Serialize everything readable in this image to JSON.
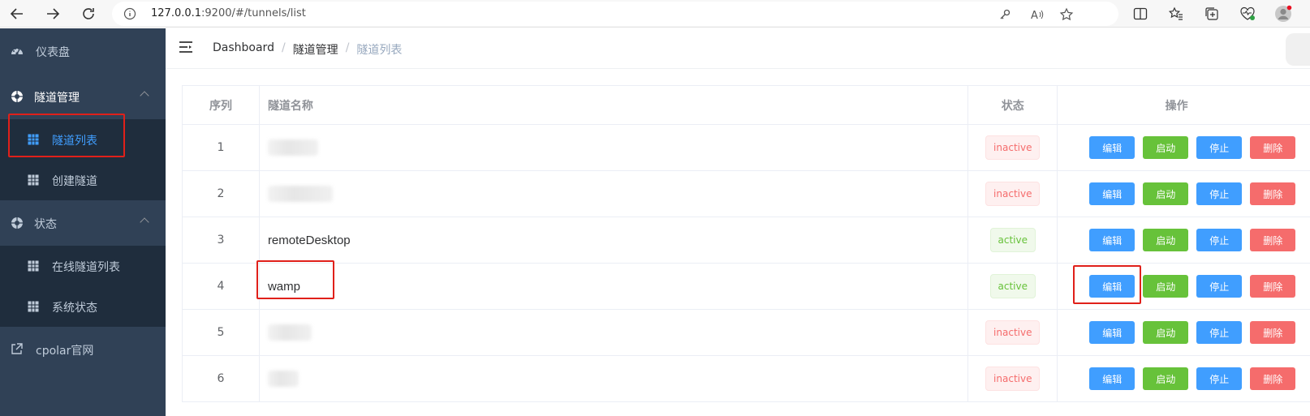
{
  "browser": {
    "url_host": "127.0.0.1",
    "url_rest": ":9200/#/tunnels/list"
  },
  "sidebar": {
    "dashboard": "仪表盘",
    "tunnel_mgmt": "隧道管理",
    "tunnel_list": "隧道列表",
    "create_tunnel": "创建隧道",
    "status": "状态",
    "online_list": "在线隧道列表",
    "system_status": "系统状态",
    "cpolar_site": "cpolar官网"
  },
  "breadcrumb": {
    "dashboard": "Dashboard",
    "mgmt": "隧道管理",
    "list": "隧道列表",
    "sep": "/"
  },
  "table": {
    "headers": {
      "index": "序列",
      "name": "隧道名称",
      "status": "状态",
      "actions": "操作"
    },
    "buttons": {
      "edit": "编辑",
      "start": "启动",
      "stop": "停止",
      "delete": "删除"
    },
    "rows": [
      {
        "index": "1",
        "name": "",
        "status": "inactive"
      },
      {
        "index": "2",
        "name": "",
        "status": "inactive"
      },
      {
        "index": "3",
        "name": "remoteDesktop",
        "status": "active"
      },
      {
        "index": "4",
        "name": "wamp",
        "status": "active"
      },
      {
        "index": "5",
        "name": "",
        "status": "inactive"
      },
      {
        "index": "6",
        "name": "",
        "status": "inactive"
      }
    ]
  },
  "colors": {
    "sidebar_bg": "#304156",
    "submenu_bg": "#1f2d3d",
    "active_text": "#409eff",
    "highlight_box": "#e0201a"
  }
}
